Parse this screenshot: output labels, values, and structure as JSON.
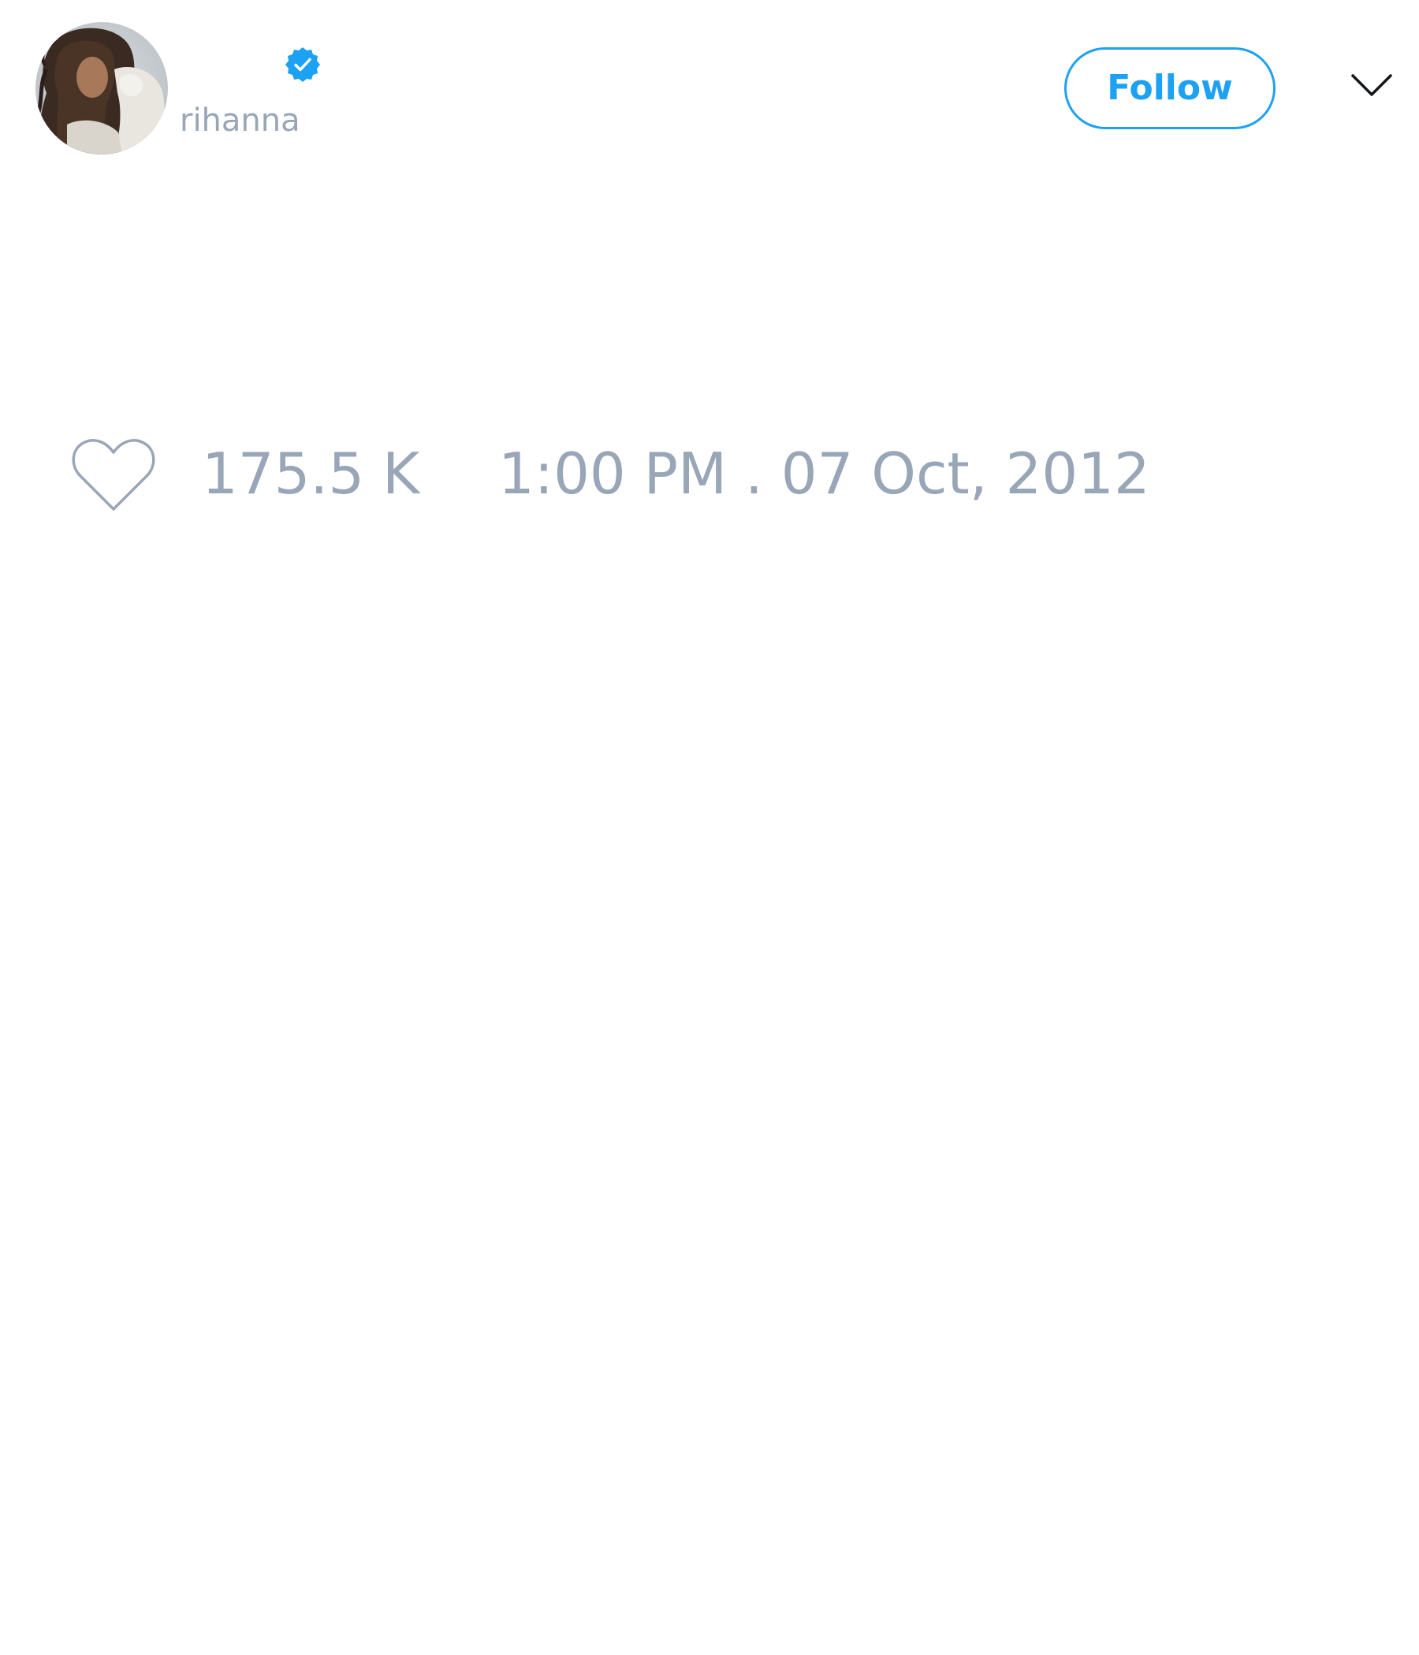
{
  "user": {
    "display_name": "",
    "username": "rihanna",
    "verified": true,
    "avatar": "profile-photo"
  },
  "header": {
    "follow_label": "Follow",
    "menu_icon": "chevron-down-icon"
  },
  "stats": {
    "like_icon": "heart-outline-icon",
    "likes": "175.5 K",
    "timestamp": "1:00 PM . 07 Oct, 2012"
  },
  "colors": {
    "accent": "#1da1f2",
    "muted_text": "#98a6b8",
    "background": "#ffffff"
  }
}
